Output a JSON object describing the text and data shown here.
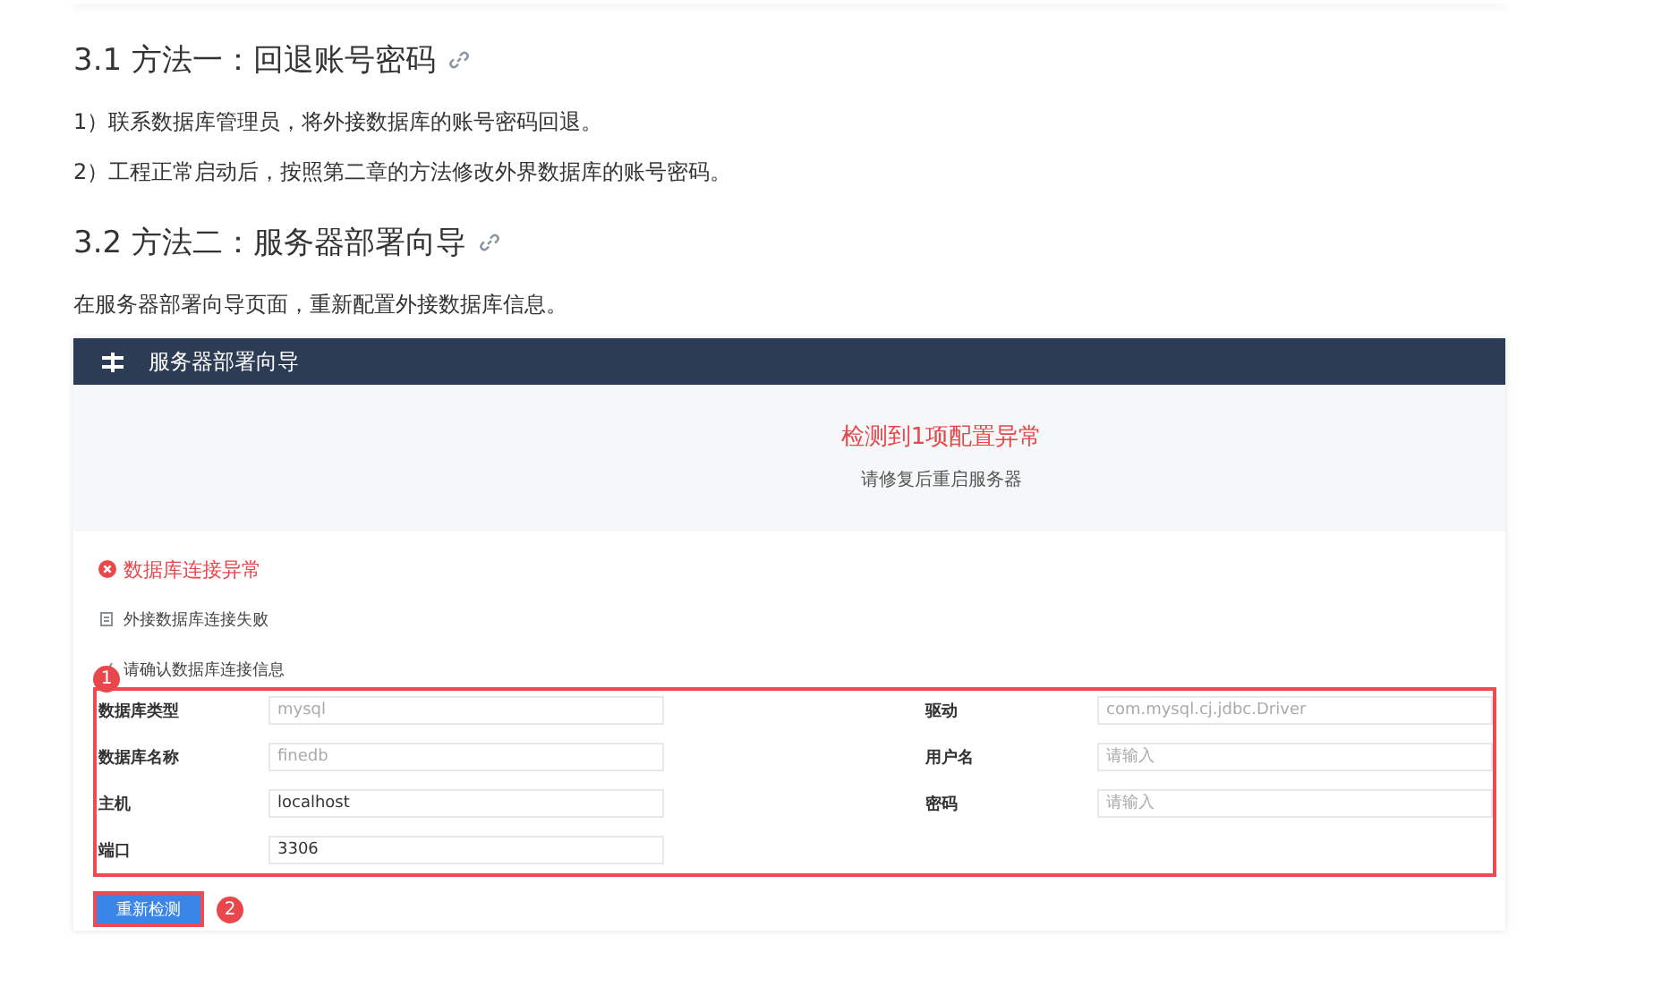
{
  "sections": [
    {
      "heading": "3.1 方法一：回退账号密码",
      "paragraphs": [
        "1）联系数据库管理员，将外接数据库的账号密码回退。",
        "2）工程正常启动后，按照第二章的方法修改外界数据库的账号密码。"
      ]
    },
    {
      "heading": "3.2 方法二：服务器部署向导",
      "paragraphs": [
        "在服务器部署向导页面，重新配置外接数据库信息。"
      ]
    }
  ],
  "screenshot": {
    "title": "服务器部署向导",
    "alert": {
      "title": "检测到1项配置异常",
      "subtitle": "请修复后重启服务器"
    },
    "error": {
      "title": "数据库连接异常",
      "items": [
        {
          "text": "外接数据库连接失败"
        },
        {
          "text": "请确认数据库连接信息"
        }
      ]
    },
    "fields_left": [
      {
        "label": "数据库类型",
        "value": "mysql",
        "disabled": true
      },
      {
        "label": "数据库名称",
        "value": "finedb",
        "disabled": true
      },
      {
        "label": "主机",
        "value": "localhost",
        "disabled": false
      },
      {
        "label": "端口",
        "value": "3306",
        "disabled": false
      }
    ],
    "fields_right": [
      {
        "label": "驱动",
        "value": "com.mysql.cj.jdbc.Driver",
        "disabled": true
      },
      {
        "label": "用户名",
        "placeholder": "请输入"
      },
      {
        "label": "密码",
        "placeholder": "请输入"
      }
    ],
    "button": "重新检测",
    "callouts": [
      "1",
      "2"
    ]
  }
}
